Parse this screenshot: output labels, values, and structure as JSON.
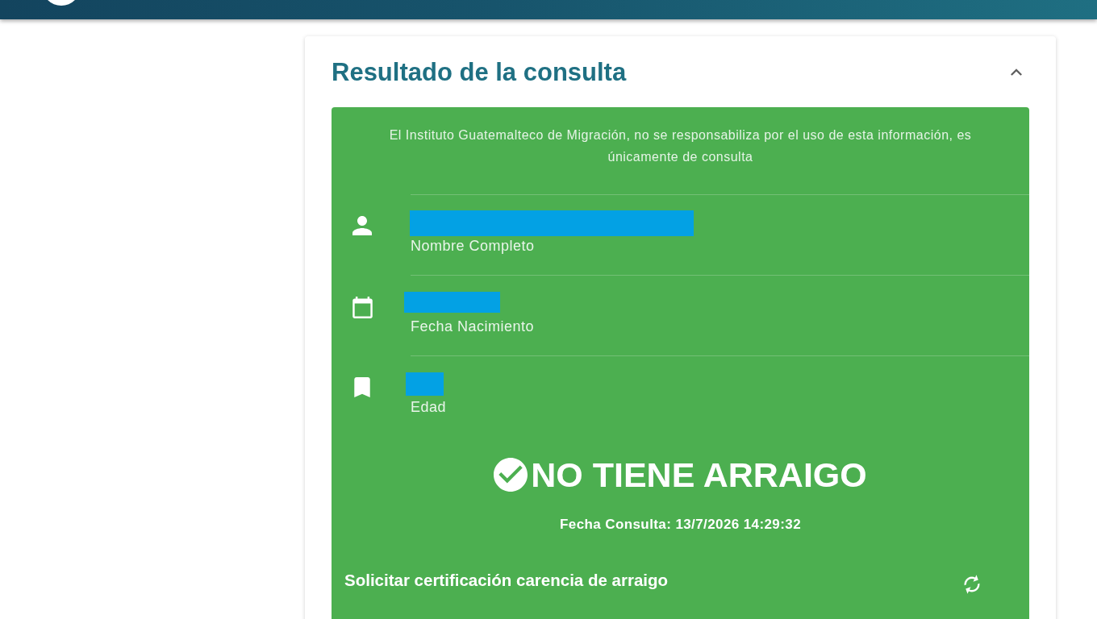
{
  "result_card": {
    "title": "Resultado de la consulta",
    "expanded": true,
    "disclaimer": "El Instituto Guatemalteco de Migración, no se responsabiliza por el uso de esta información, es únicamente de consulta",
    "fields": [
      {
        "kind": "name",
        "label": "Nombre Completo",
        "redacted": true
      },
      {
        "kind": "date",
        "label": "Fecha Nacimiento",
        "redacted": true
      },
      {
        "kind": "age",
        "label": "Edad",
        "redacted": true
      }
    ],
    "outcome": {
      "found": false,
      "text": "NO TIENE ARRAIGO"
    },
    "query_date": "Fecha Consulta: 13/7/2026 14:29:32",
    "certification": {
      "label": "Solicitar certificación carencia de arraigo"
    }
  }
}
